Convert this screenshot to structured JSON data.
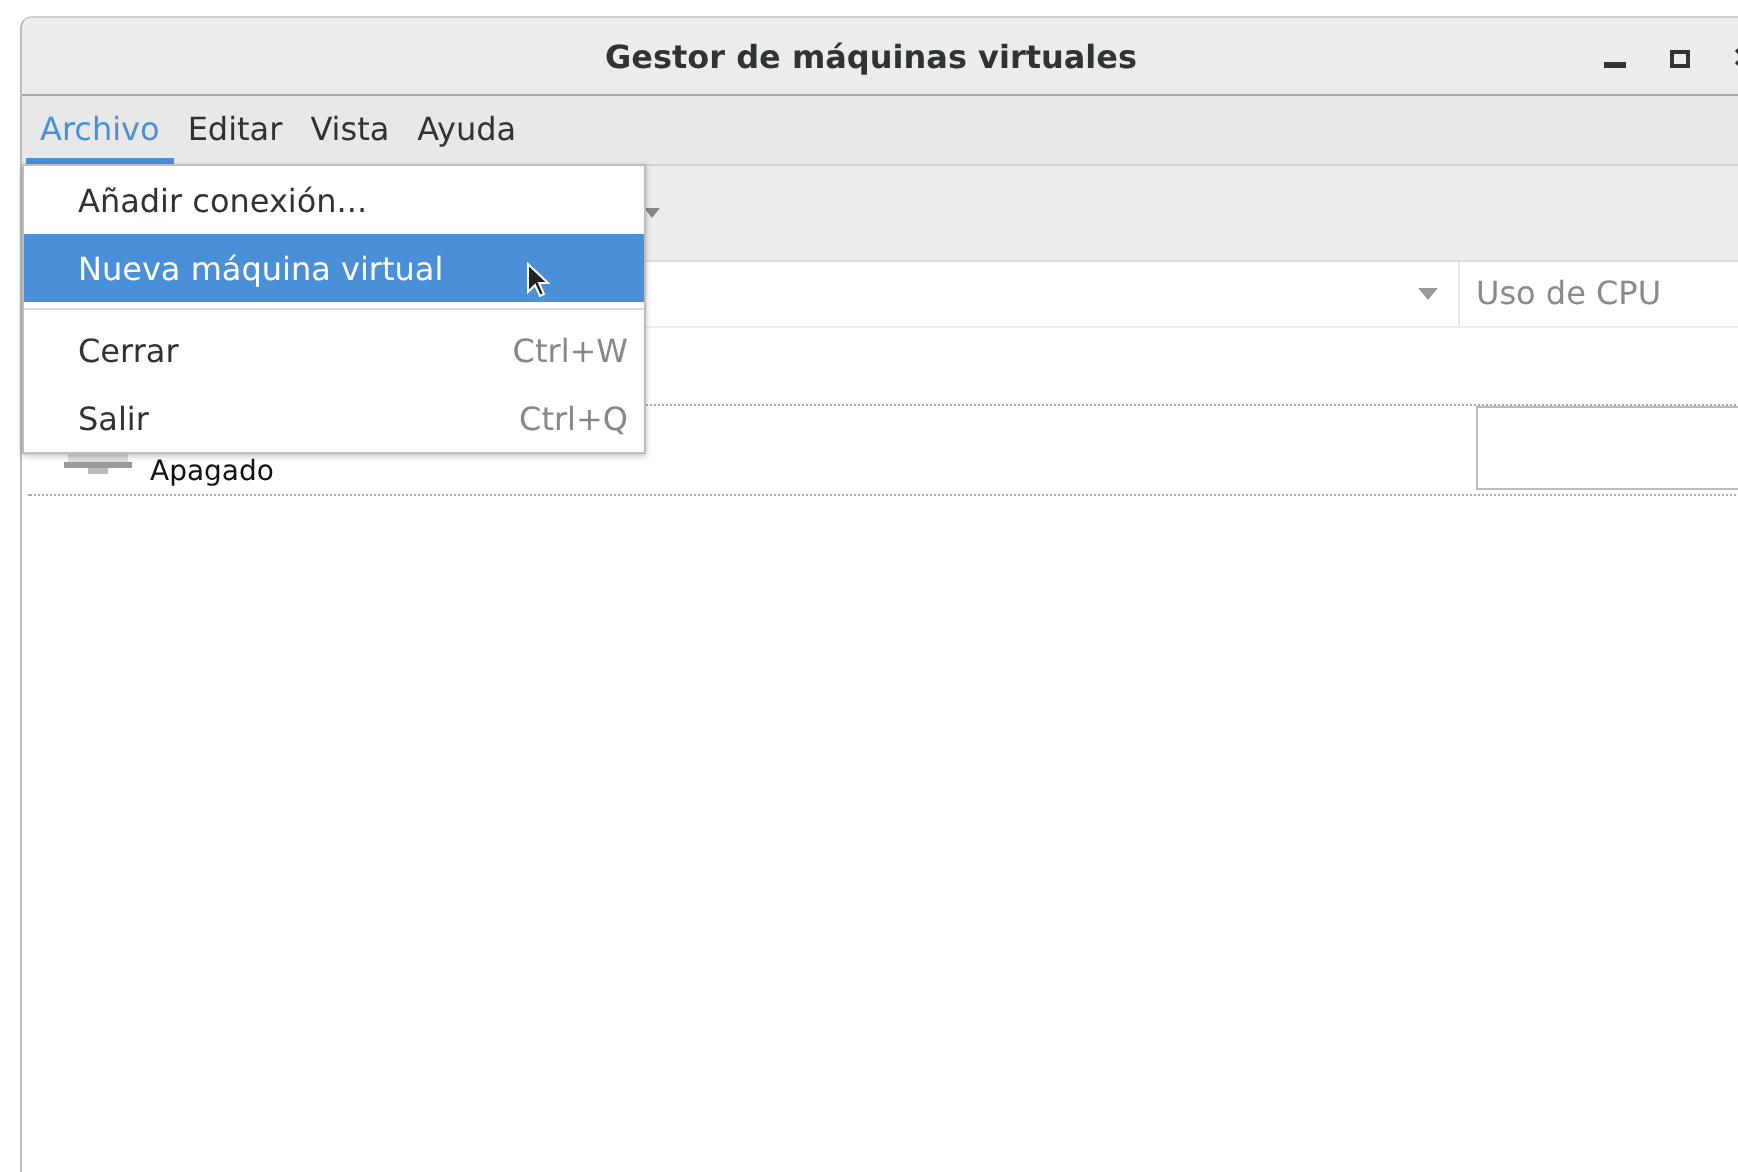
{
  "window": {
    "title": "Gestor de máquinas virtuales"
  },
  "menubar": [
    {
      "label": "Archivo",
      "selected": true
    },
    {
      "label": "Editar",
      "selected": false
    },
    {
      "label": "Vista",
      "selected": false
    },
    {
      "label": "Ayuda",
      "selected": false
    }
  ],
  "menu": [
    {
      "label": "Añadir conexión...",
      "selected": false,
      "separator_before": false
    },
    {
      "label": "Nueva máquina virtual",
      "selected": true,
      "separator_before": false
    },
    {
      "label": "Cerrar",
      "shortcut": "Ctrl+W",
      "selected": false,
      "separator_before": true
    },
    {
      "label": "Salir",
      "shortcut": "Ctrl+Q",
      "selected": false,
      "separator_before": false
    }
  ],
  "table": {
    "columns": [
      {
        "label": "Uso de CPU"
      }
    ],
    "rows": [
      {
        "status": "Apagado"
      }
    ]
  }
}
